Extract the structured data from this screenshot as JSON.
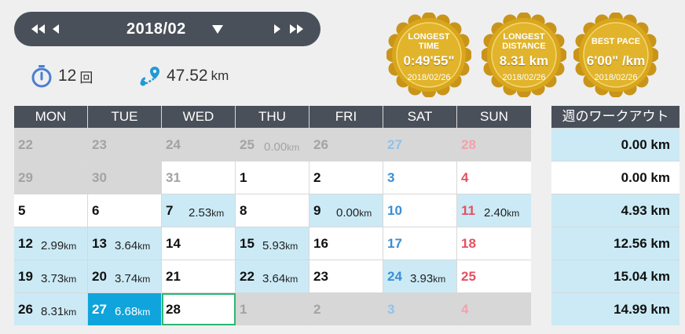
{
  "nav": {
    "month": "2018/02"
  },
  "stats": {
    "count_value": "12",
    "count_unit": "回",
    "distance_value": "47.52",
    "distance_unit": "km"
  },
  "badges": [
    {
      "title1": "LONGEST",
      "title2": "TIME",
      "value": "0:49'55\"",
      "date": "2018/02/26"
    },
    {
      "title1": "LONGEST",
      "title2": "DISTANCE",
      "value": "8.31 km",
      "date": "2018/02/26"
    },
    {
      "title1": "BEST PACE",
      "title2": "",
      "value": "6'00\" /km",
      "date": "2018/02/26"
    }
  ],
  "calendar": {
    "weekdays": [
      "MON",
      "TUE",
      "WED",
      "THU",
      "FRI",
      "SAT",
      "SUN"
    ],
    "weeks": [
      [
        {
          "d": "22",
          "km": ""
        },
        {
          "d": "23",
          "km": ""
        },
        {
          "d": "24",
          "km": ""
        },
        {
          "d": "25",
          "km": "0.00"
        },
        {
          "d": "26",
          "km": ""
        },
        {
          "d": "27",
          "km": ""
        },
        {
          "d": "28",
          "km": ""
        }
      ],
      [
        {
          "d": "29",
          "km": ""
        },
        {
          "d": "30",
          "km": ""
        },
        {
          "d": "31",
          "km": ""
        },
        {
          "d": "1",
          "km": ""
        },
        {
          "d": "2",
          "km": ""
        },
        {
          "d": "3",
          "km": ""
        },
        {
          "d": "4",
          "km": ""
        }
      ],
      [
        {
          "d": "5",
          "km": ""
        },
        {
          "d": "6",
          "km": ""
        },
        {
          "d": "7",
          "km": "2.53"
        },
        {
          "d": "8",
          "km": ""
        },
        {
          "d": "9",
          "km": "0.00"
        },
        {
          "d": "10",
          "km": ""
        },
        {
          "d": "11",
          "km": "2.40"
        }
      ],
      [
        {
          "d": "12",
          "km": "2.99"
        },
        {
          "d": "13",
          "km": "3.64"
        },
        {
          "d": "14",
          "km": ""
        },
        {
          "d": "15",
          "km": "5.93"
        },
        {
          "d": "16",
          "km": ""
        },
        {
          "d": "17",
          "km": ""
        },
        {
          "d": "18",
          "km": ""
        }
      ],
      [
        {
          "d": "19",
          "km": "3.73"
        },
        {
          "d": "20",
          "km": "3.74"
        },
        {
          "d": "21",
          "km": ""
        },
        {
          "d": "22",
          "km": "3.64"
        },
        {
          "d": "23",
          "km": ""
        },
        {
          "d": "24",
          "km": "3.93"
        },
        {
          "d": "25",
          "km": ""
        }
      ],
      [
        {
          "d": "26",
          "km": "8.31"
        },
        {
          "d": "27",
          "km": "6.68"
        },
        {
          "d": "28",
          "km": ""
        },
        {
          "d": "1",
          "km": ""
        },
        {
          "d": "2",
          "km": ""
        },
        {
          "d": "3",
          "km": ""
        },
        {
          "d": "4",
          "km": ""
        }
      ]
    ],
    "km_unit": "km"
  },
  "weekly": {
    "title": "週のワークアウト",
    "totals": [
      "0.00 km",
      "0.00 km",
      "4.93 km",
      "12.56 km",
      "15.04 km",
      "14.99 km"
    ]
  },
  "colors": {
    "header_bg": "#4a505a",
    "workout_bg": "#cbeaf5",
    "selected_bg": "#0fa4db",
    "today_border": "#2bb673",
    "badge_gold": "#d9a61c"
  }
}
